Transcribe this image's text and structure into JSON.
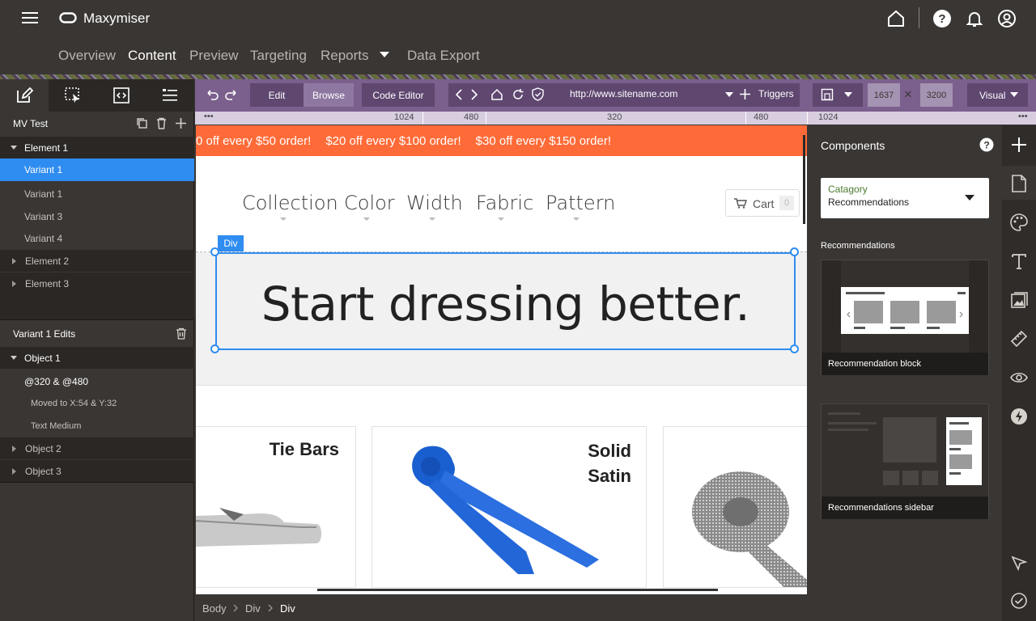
{
  "app": {
    "name": "Maxymiser"
  },
  "header": {
    "nav": [
      "Overview",
      "Content",
      "Preview",
      "Targeting",
      "Reports",
      "Data Export"
    ],
    "active": "Content",
    "icons": [
      "home-icon",
      "help-icon",
      "notifications-icon",
      "account-icon"
    ]
  },
  "left": {
    "test_title": "MV Test",
    "elements": [
      {
        "label": "Element 1"
      },
      {
        "label": "Variant 1"
      },
      {
        "label": "Variant 1"
      },
      {
        "label": "Variant 3"
      },
      {
        "label": "Variant 4"
      },
      {
        "label": "Element 2"
      },
      {
        "label": "Element 3"
      }
    ],
    "edits_title": "Variant 1 Edits",
    "objects": [
      {
        "label": "Object 1"
      },
      {
        "label": "@320 & @480"
      },
      {
        "label": "Moved to X:54 & Y:32"
      },
      {
        "label": "Text Medium"
      },
      {
        "label": "Object 2"
      },
      {
        "label": "Object 3"
      }
    ]
  },
  "toolbar": {
    "edit": "Edit",
    "browse": "Browse",
    "code_editor": "Code Editor",
    "url": "http://www.sitename.com",
    "triggers": "Triggers",
    "width": "1637",
    "height": "3200",
    "times": "×",
    "mode": "Visual"
  },
  "ruler": {
    "labels": [
      "1024",
      "480",
      "320",
      "480",
      "1024"
    ],
    "more": "•••"
  },
  "canvas": {
    "promo": [
      "0 off every $50 order!",
      "$20 off every $100 order!",
      "$30 off every $150 order!"
    ],
    "menu": [
      "Collection",
      "Color",
      "Width",
      "Fabric",
      "Pattern"
    ],
    "cart": "Cart",
    "cart_count": "0",
    "div_tag": "Div",
    "hero": "Start dressing better.",
    "cards": [
      "Tie Bars",
      "Solid Satin"
    ]
  },
  "breadcrumb": [
    "Body",
    "Div",
    "Div"
  ],
  "components": {
    "title": "Components",
    "dropdown_label": "Catagory",
    "dropdown_value": "Recommendations",
    "section": "Recommendations",
    "items": [
      "Recommendation block",
      "Recommendations sidebar"
    ]
  },
  "colors": {
    "accent": "#2f8cf0",
    "toolbar": "#7b5f8c",
    "promo": "#ff6b38",
    "category_green": "#4a7a2e"
  }
}
